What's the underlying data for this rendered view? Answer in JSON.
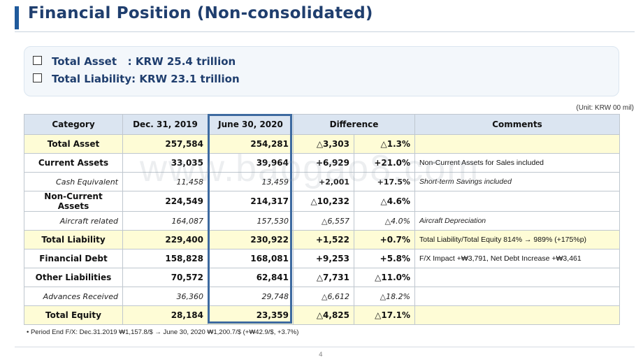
{
  "title": "Financial Position (Non-consolidated)",
  "summary": {
    "line1": "Total Asset   : KRW 25.4 trillion",
    "line2": "Total Liability: KRW 23.1 trillion"
  },
  "unit": "(Unit: KRW 00 mil)",
  "table": {
    "headers": {
      "category": "Category",
      "dec": "Dec. 31, 2019",
      "june": "June 30, 2020",
      "difference": "Difference",
      "comments": "Comments"
    },
    "rows": [
      {
        "category": "Total Asset",
        "dec": "257,584",
        "june": "254,281",
        "diff": "△3,303",
        "pct": "△1.3%",
        "comment": ""
      },
      {
        "category": "Current Assets",
        "dec": "33,035",
        "june": "39,964",
        "diff": "+6,929",
        "pct": "+21.0%",
        "comment": "Non-Current Assets for Sales included"
      },
      {
        "category": "Cash Equivalent",
        "dec": "11,458",
        "june": "13,459",
        "diff": "+2,001",
        "pct": "+17.5%",
        "comment": "Short-term Savings included"
      },
      {
        "category": "Non-Current Assets",
        "dec": "224,549",
        "june": "214,317",
        "diff": "△10,232",
        "pct": "△4.6%",
        "comment": ""
      },
      {
        "category": "Aircraft related",
        "dec": "164,087",
        "june": "157,530",
        "diff": "△6,557",
        "pct": "△4.0%",
        "comment": "Aircraft Depreciation"
      },
      {
        "category": "Total Liability",
        "dec": "229,400",
        "june": "230,922",
        "diff": "+1,522",
        "pct": "+0.7%",
        "comment": "Total Liability/Total Equity 814% → 989%  (+175%p)"
      },
      {
        "category": "Financial Debt",
        "dec": "158,828",
        "june": "168,081",
        "diff": "+9,253",
        "pct": "+5.8%",
        "comment": "F/X Impact +₩3,791, Net Debt Increase +₩3,461"
      },
      {
        "category": "Other Liabilities",
        "dec": "70,572",
        "june": "62,841",
        "diff": "△7,731",
        "pct": "△11.0%",
        "comment": ""
      },
      {
        "category": "Advances Received",
        "dec": "36,360",
        "june": "29,748",
        "diff": "△6,612",
        "pct": "△18.2%",
        "comment": ""
      },
      {
        "category": "Total Equity",
        "dec": "28,184",
        "june": "23,359",
        "diff": "△4,825",
        "pct": "△17.1%",
        "comment": ""
      }
    ]
  },
  "watermark": "www.baogao8.com",
  "footnote": "•   Period End F/X:  Dec.31.2019  ₩1,157.8/$ → June 30, 2020 ₩1,200.7/$ (+₩42.9/$, +3.7%)",
  "page_number": "4"
}
